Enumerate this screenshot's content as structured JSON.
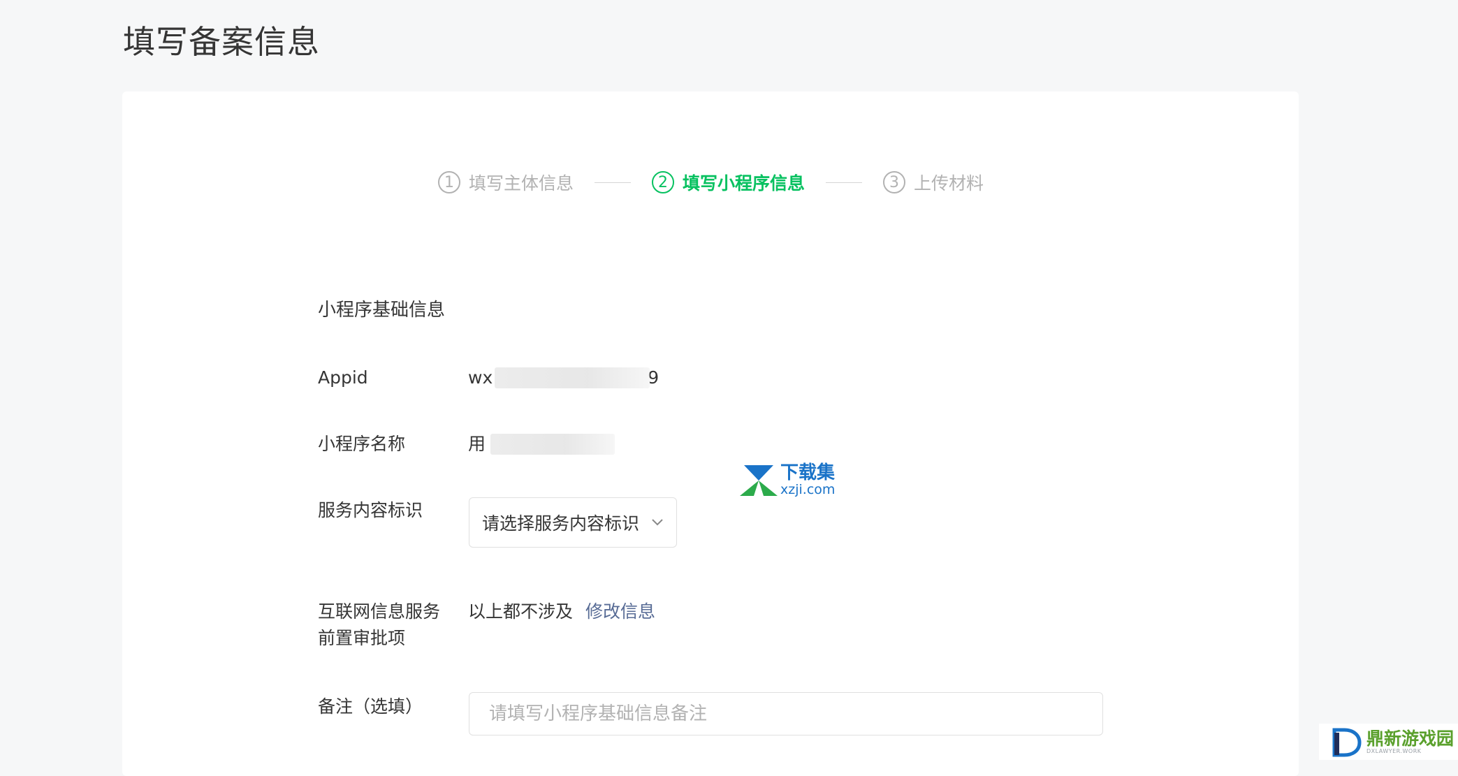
{
  "page": {
    "title": "填写备案信息"
  },
  "steps": [
    {
      "num": "1",
      "label": "填写主体信息",
      "state": "done"
    },
    {
      "num": "2",
      "label": "填写小程序信息",
      "state": "active"
    },
    {
      "num": "3",
      "label": "上传材料",
      "state": "pending"
    }
  ],
  "form": {
    "section_title": "小程序基础信息",
    "appid": {
      "label": "Appid",
      "value_prefix": "wx",
      "value_suffix": "9"
    },
    "name": {
      "label": "小程序名称",
      "value_prefix": "用"
    },
    "service": {
      "label": "服务内容标识",
      "placeholder": "请选择服务内容标识"
    },
    "preapproval": {
      "label_line1": "互联网信息服务",
      "label_line2": "前置审批项",
      "value": "以上都不涉及",
      "link": "修改信息"
    },
    "remark": {
      "label": "备注（选填）",
      "placeholder": "请填写小程序基础信息备注"
    }
  },
  "watermarks": {
    "center_cn": "下载集",
    "center_en": "xzji.com",
    "corner_cn": "鼎新游戏园",
    "corner_en": "DXLAWYER.WORK"
  },
  "colors": {
    "accent": "#07c160",
    "link": "#576b95",
    "muted": "#b2b2b2"
  }
}
